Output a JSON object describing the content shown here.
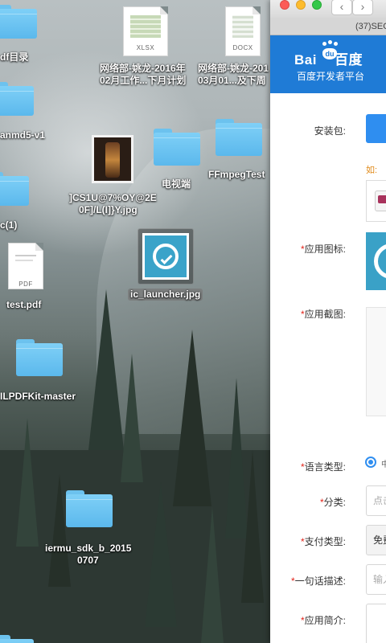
{
  "desktop": {
    "items": [
      {
        "name": "pdf-catalog-folder",
        "label": "df目录"
      },
      {
        "name": "xlsx-file",
        "label_line1": "网络部-姚龙-2016年",
        "label_line2": "02月工作...下月计划",
        "badge": "XLSX"
      },
      {
        "name": "docx-file",
        "label_line1": "网络部-姚龙-201",
        "label_line2": "03月01...及下周",
        "badge": "DOCX"
      },
      {
        "name": "anmd5-folder",
        "label": "anmd5-v1"
      },
      {
        "name": "jpg-file",
        "label_line1": "]CS1U@7%OY@2E",
        "label_line2": "0F]/L(I]}Y.jpg"
      },
      {
        "name": "tv-folder",
        "label": "电视端"
      },
      {
        "name": "ffmpeg-folder",
        "label": "FFmpegTest"
      },
      {
        "name": "c1-folder",
        "label": "c(1)"
      },
      {
        "name": "launcher-jpg",
        "label": "ic_launcher.jpg"
      },
      {
        "name": "test-pdf",
        "label": "test.pdf",
        "badge": "PDF"
      },
      {
        "name": "pdfkit-folder",
        "label": "ILPDFKit-master"
      },
      {
        "name": "iermu-folder",
        "label_line1": "iermu_sdk_b_2015",
        "label_line2": "0707"
      }
    ]
  },
  "browser": {
    "tab_title": "(37)SEC",
    "nav_back": "‹",
    "nav_forward": "›",
    "header": {
      "logo_left": "Bai",
      "logo_du": "du",
      "logo_right": "百度",
      "subtitle": "百度开发者平台"
    },
    "form": {
      "install_package_label": "安装包:",
      "hint": "如: ",
      "app_icon_label": "应用图标:",
      "screenshot_label": "应用截图:",
      "language_label": "语言类型:",
      "language_option": "中",
      "category_label": "分类:",
      "category_placeholder": "点击",
      "pay_type_label": "支付类型:",
      "pay_type_value": "免费",
      "one_line_label": "一句话描述:",
      "one_line_placeholder": "输入",
      "intro_label": "应用简介:",
      "required_mark": "*"
    }
  },
  "colors": {
    "baidu_blue": "#1f7bd6",
    "button_blue": "#2f8ef0",
    "required_red": "#e2231a",
    "hint_orange": "#e08a1a",
    "folder_blue": "#5bb8ec"
  }
}
